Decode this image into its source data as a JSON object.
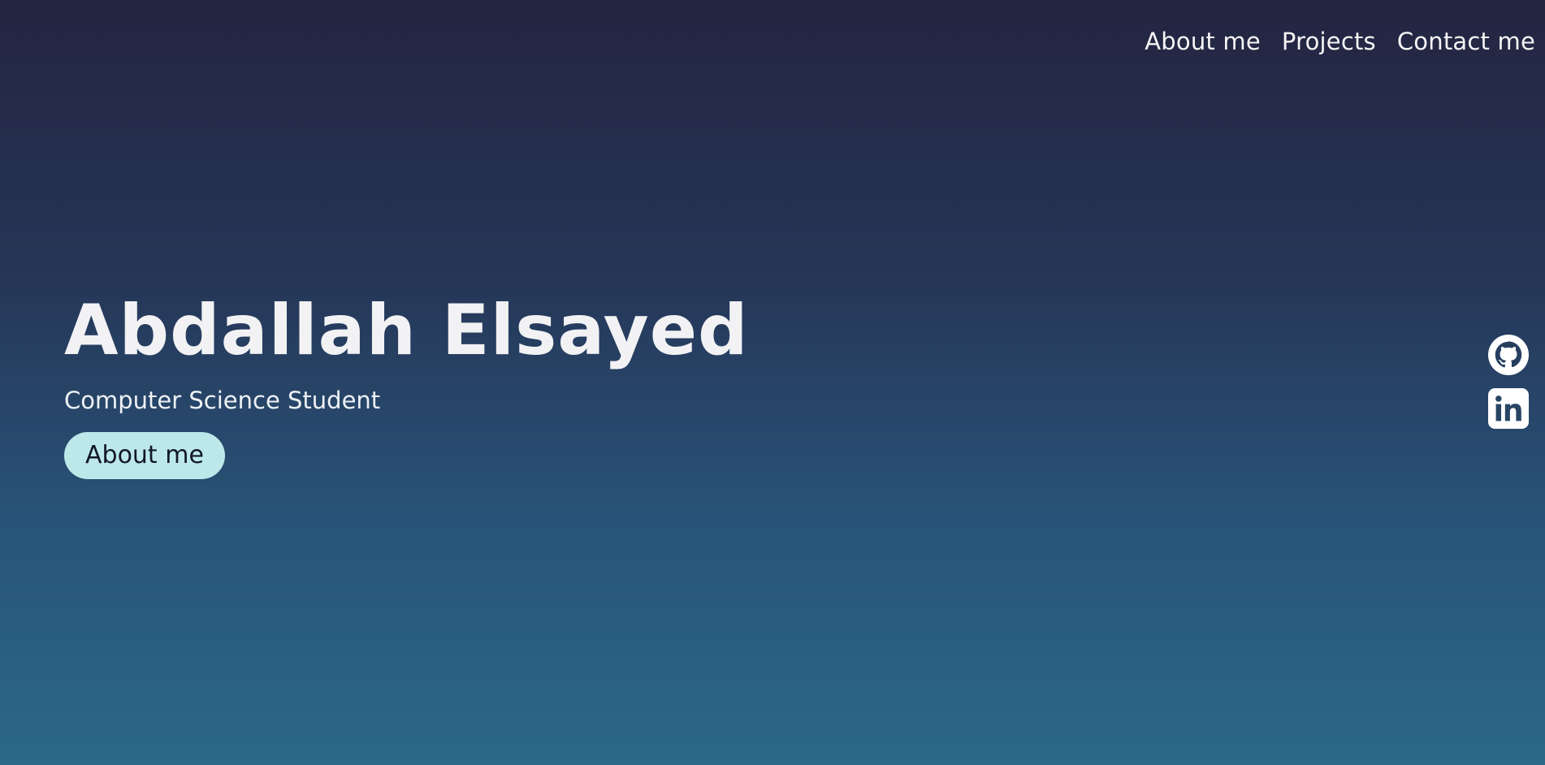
{
  "nav": {
    "items": [
      {
        "label": "About me"
      },
      {
        "label": "Projects"
      },
      {
        "label": "Contact me"
      }
    ]
  },
  "hero": {
    "name": "Abdallah Elsayed",
    "subtitle": "Computer Science Student",
    "cta_label": "About me"
  },
  "social": {
    "items": [
      {
        "icon": "github-icon"
      },
      {
        "icon": "linkedin-icon"
      }
    ]
  },
  "colors": {
    "gradient_top": "#242541",
    "gradient_bottom": "#2b6889",
    "cta_bg": "#bde8e9",
    "text": "#f3f3f3"
  }
}
